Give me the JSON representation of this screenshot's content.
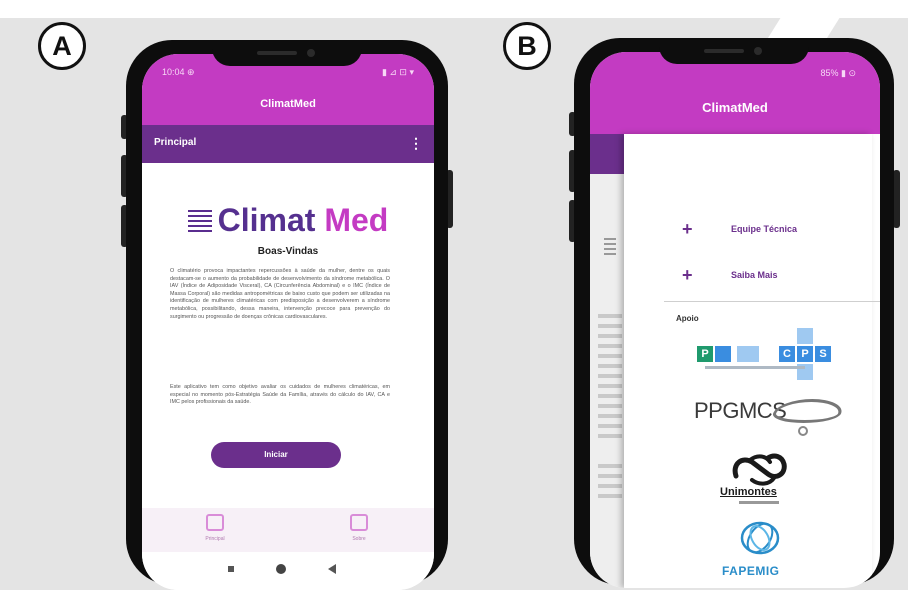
{
  "panels": {
    "a_label": "A",
    "b_label": "B"
  },
  "phone_a": {
    "status_left": "10:04 ⊕",
    "status_right": "▮ ⊿ ⊡ ▾",
    "app_title": "ClimatMed",
    "toolbar_title": "Principal",
    "menu_icon": "⋮",
    "logo_part1": "Climat",
    "logo_part2": "Med",
    "welcome": "Boas-Vindas",
    "paragraphs": [
      "O climatério provoca impactantes repercussões à saúde da mulher, dentre os quais destacam-se o aumento da probabilidade de desenvolvimento da síndrome metabólica. O IAV (Índice de Adiposidade Visceral), CA (Circunferência Abdominal) e o IMC (Índice de Massa Corporal) são medidas antropométricas de baixo custo que podem ser utilizadas na identificação de mulheres climatéricas com predisposição a desenvolverem a síndrome metabólica, possibilitando, dessa maneira, intervenção precoce para prevenção do surgimento ou progressão de doenças crônicas cardiovasculares.",
      "Este aplicativo tem como objetivo avaliar os cuidados de mulheres climatéricas, em especial no momento pós-Estratégia Saúde da Família, através do cálculo do IAV, CA e IMC pelos profissionais da saúde."
    ],
    "start_button": "Iniciar",
    "nav_left": "Principal",
    "nav_right": "Sobre"
  },
  "phone_b": {
    "status_right": "85% ▮ ⊙",
    "app_title": "ClimatMed",
    "menu_items": [
      {
        "icon": "+",
        "label": "Equipe Técnica"
      },
      {
        "icon": "+",
        "label": "Saiba Mais"
      }
    ],
    "support_title": "Apoio",
    "ppgcps_letters": [
      "P",
      "C",
      "P",
      "S"
    ],
    "ppgmcs_text": "PPGMCS",
    "unimontes_text": "Unimontes",
    "fapemig_text": "FAPEMIG"
  },
  "colors": {
    "header": "#c33bc2",
    "toolbar": "#6b2f8c",
    "accent": "#55308f"
  }
}
